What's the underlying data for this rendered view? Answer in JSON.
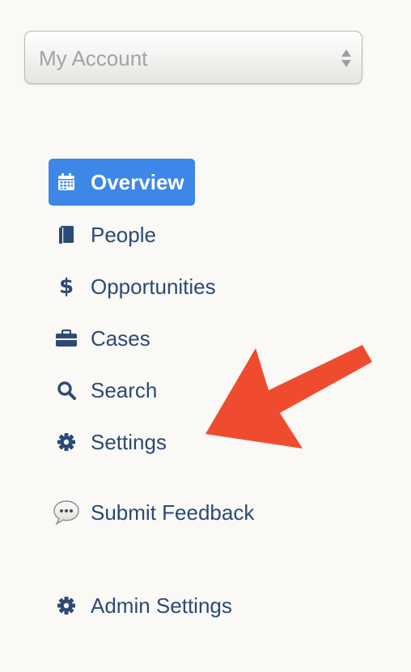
{
  "account_select": {
    "value": "My Account"
  },
  "nav": {
    "items": [
      {
        "label": "Overview",
        "icon": "calendar-icon",
        "active": true
      },
      {
        "label": "People",
        "icon": "book-icon"
      },
      {
        "label": "Opportunities",
        "icon": "dollar-icon",
        "glyph": "$"
      },
      {
        "label": "Cases",
        "icon": "briefcase-icon"
      },
      {
        "label": "Search",
        "icon": "search-icon"
      },
      {
        "label": "Settings",
        "icon": "gear-icon"
      },
      {
        "label": "Submit Feedback",
        "icon": "speech-bubble-icon"
      },
      {
        "label": "Admin Settings",
        "icon": "gear-icon"
      }
    ]
  },
  "annotation": {
    "type": "arrow",
    "color": "#ef4c2f",
    "points_to": "Settings"
  },
  "colors": {
    "background": "#faf9f5",
    "nav_text": "#2b4a75",
    "active_bg": "#3d87e8",
    "active_text": "#ffffff",
    "placeholder_text": "#a3a3a3"
  }
}
